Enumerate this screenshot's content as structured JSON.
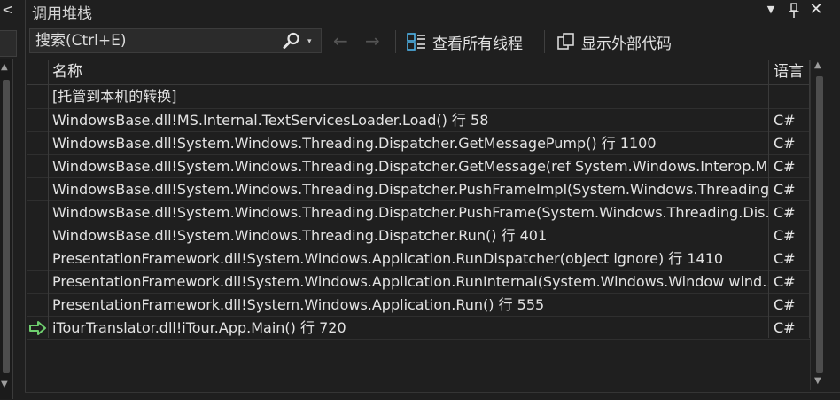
{
  "left_panel": {
    "collapse_caret": "<"
  },
  "title": "调用堆栈",
  "title_buttons": {
    "dropdown": "▼",
    "pin": "📌",
    "close": "✕"
  },
  "toolbar": {
    "search_placeholder": "搜索(Ctrl+E)",
    "search_dropdown": "▾",
    "back_arrow": "←",
    "forward_arrow": "→",
    "show_all_threads_label": "查看所有线程",
    "show_external_code_label": "显示外部代码"
  },
  "columns": {
    "name": "名称",
    "language": "语言"
  },
  "rows": [
    {
      "name": "[托管到本机的转换]",
      "lang": ""
    },
    {
      "name": "WindowsBase.dll!MS.Internal.TextServicesLoader.Load() 行 58",
      "lang": "C#"
    },
    {
      "name": "WindowsBase.dll!System.Windows.Threading.Dispatcher.GetMessagePump() 行 1100",
      "lang": "C#"
    },
    {
      "name": "WindowsBase.dll!System.Windows.Threading.Dispatcher.GetMessage(ref System.Windows.Interop.M...",
      "lang": "C#"
    },
    {
      "name": "WindowsBase.dll!System.Windows.Threading.Dispatcher.PushFrameImpl(System.Windows.Threading...",
      "lang": "C#"
    },
    {
      "name": "WindowsBase.dll!System.Windows.Threading.Dispatcher.PushFrame(System.Windows.Threading.Dis...",
      "lang": "C#"
    },
    {
      "name": "WindowsBase.dll!System.Windows.Threading.Dispatcher.Run() 行 401",
      "lang": "C#"
    },
    {
      "name": "PresentationFramework.dll!System.Windows.Application.RunDispatcher(object ignore) 行 1410",
      "lang": "C#"
    },
    {
      "name": "PresentationFramework.dll!System.Windows.Application.RunInternal(System.Windows.Window wind...",
      "lang": "C#"
    },
    {
      "name": "PresentationFramework.dll!System.Windows.Application.Run() 行 555",
      "lang": "C#"
    },
    {
      "name": "iTourTranslator.dll!iTour.App.Main() 行 720",
      "lang": "C#",
      "current": true
    }
  ],
  "colors": {
    "background": "#1f1f1f",
    "text": "#e3e3e3",
    "current_frame_arrow": "#6fcf6f",
    "grid_line": "#3a3a3a"
  }
}
